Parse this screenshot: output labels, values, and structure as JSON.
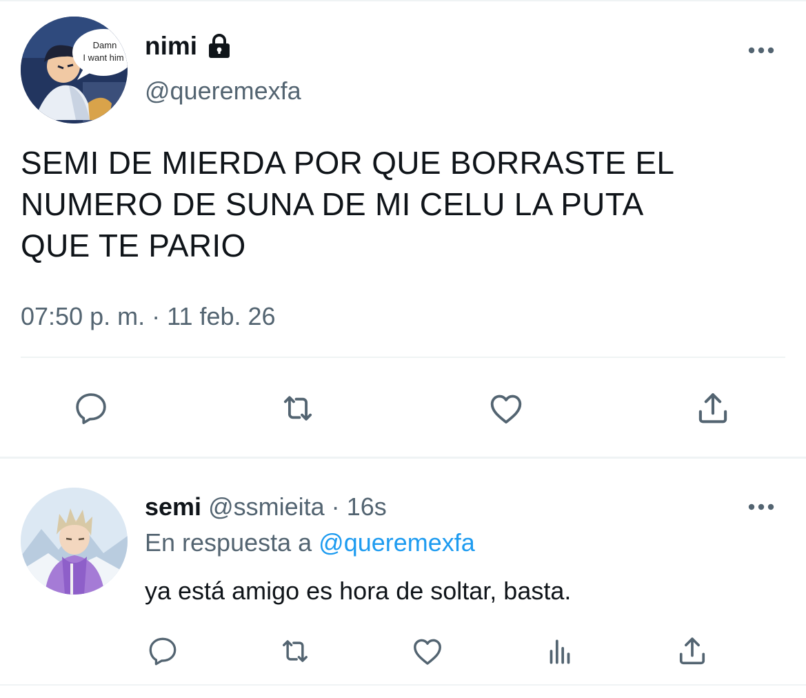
{
  "tweet": {
    "display_name": "nimi",
    "protected_icon": "lock-icon",
    "handle": "@queremexfa",
    "text": "SEMI DE MIERDA POR QUE BORRASTE EL\nNUMERO DE SUNA DE MI CELU LA PUTA\nQUE TE PARIO",
    "time": "07:50 p. m.",
    "separator": "·",
    "date": "11 feb. 26",
    "avatar_speech": [
      "Damn",
      "I want him"
    ],
    "actions": [
      "reply-icon",
      "retweet-icon",
      "like-icon",
      "share-icon"
    ],
    "more_icon": "more-icon"
  },
  "reply": {
    "display_name": "semi",
    "handle": "@ssmieita",
    "separator": "·",
    "time": "16s",
    "reply_to_prefix": "En respuesta a",
    "reply_to_handle": "@queremexfa",
    "text": "ya está amigo es hora de soltar, basta.",
    "actions": [
      "reply-icon",
      "retweet-icon",
      "like-icon",
      "analytics-icon",
      "share-icon"
    ],
    "more_icon": "more-icon"
  },
  "colors": {
    "text": "#0f1419",
    "secondary": "#536471",
    "link": "#1d9bf0",
    "divider": "#eff3f4"
  }
}
